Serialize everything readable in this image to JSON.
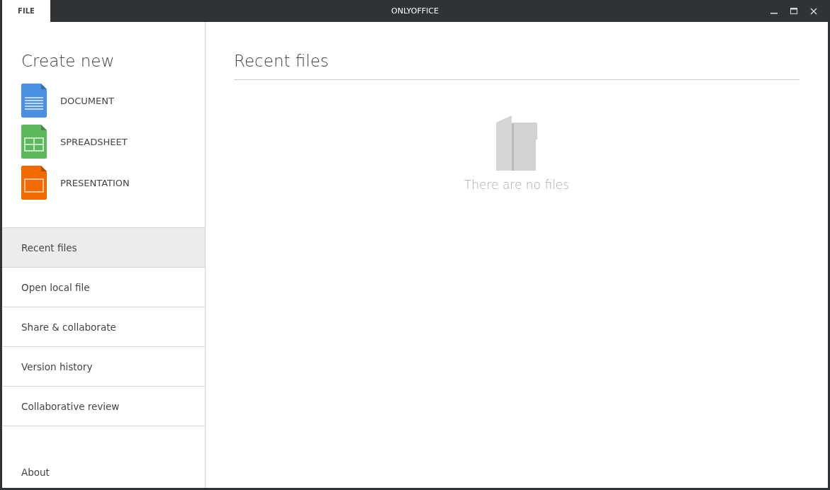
{
  "window": {
    "title": "ONLYOFFICE",
    "tab": "FILE"
  },
  "create_new": {
    "title": "Create new",
    "items": [
      {
        "kind": "document",
        "label": "DOCUMENT"
      },
      {
        "kind": "spreadsheet",
        "label": "SPREADSHEET"
      },
      {
        "kind": "presentation",
        "label": "PRESENTATION"
      }
    ]
  },
  "menu": [
    {
      "label": "Recent files",
      "selected": true
    },
    {
      "label": "Open local file",
      "selected": false
    },
    {
      "label": "Share & collaborate",
      "selected": false
    },
    {
      "label": "Version history",
      "selected": false
    },
    {
      "label": "Collaborative review",
      "selected": false
    }
  ],
  "about": "About",
  "content": {
    "title": "Recent files",
    "empty_message": "There are no files"
  }
}
